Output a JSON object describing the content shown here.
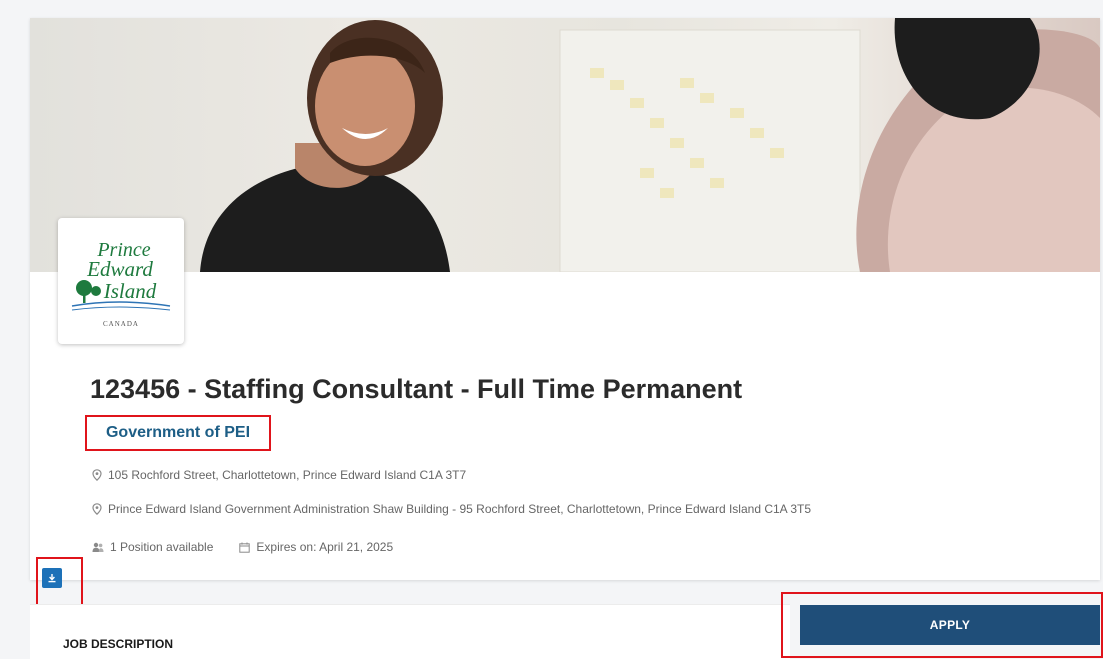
{
  "job": {
    "title": "123456 - Staffing Consultant - Full Time Permanent",
    "employer": "Government of PEI",
    "locations": [
      "105 Rochford Street, Charlottetown, Prince Edward Island C1A 3T7",
      "Prince Edward Island Government Administration Shaw Building - 95 Rochford Street, Charlottetown, Prince Edward Island C1A 3T5"
    ],
    "positions": "1 Position available",
    "expires": "Expires on: April 21, 2025"
  },
  "logo": {
    "line1": "Prince",
    "line2": "Edward",
    "line3": "Island",
    "country": "CANADA"
  },
  "actions": {
    "apply_label": "APPLY"
  },
  "sections": {
    "job_description": "JOB DESCRIPTION"
  },
  "colors": {
    "accent_blue": "#1f4e79",
    "link_blue": "#1d5e86",
    "logo_green": "#1e7a3e",
    "highlight_red": "#e0141b"
  },
  "icons": {
    "location": "map-pin-icon",
    "positions": "people-icon",
    "expires": "calendar-icon",
    "download": "download-icon"
  }
}
